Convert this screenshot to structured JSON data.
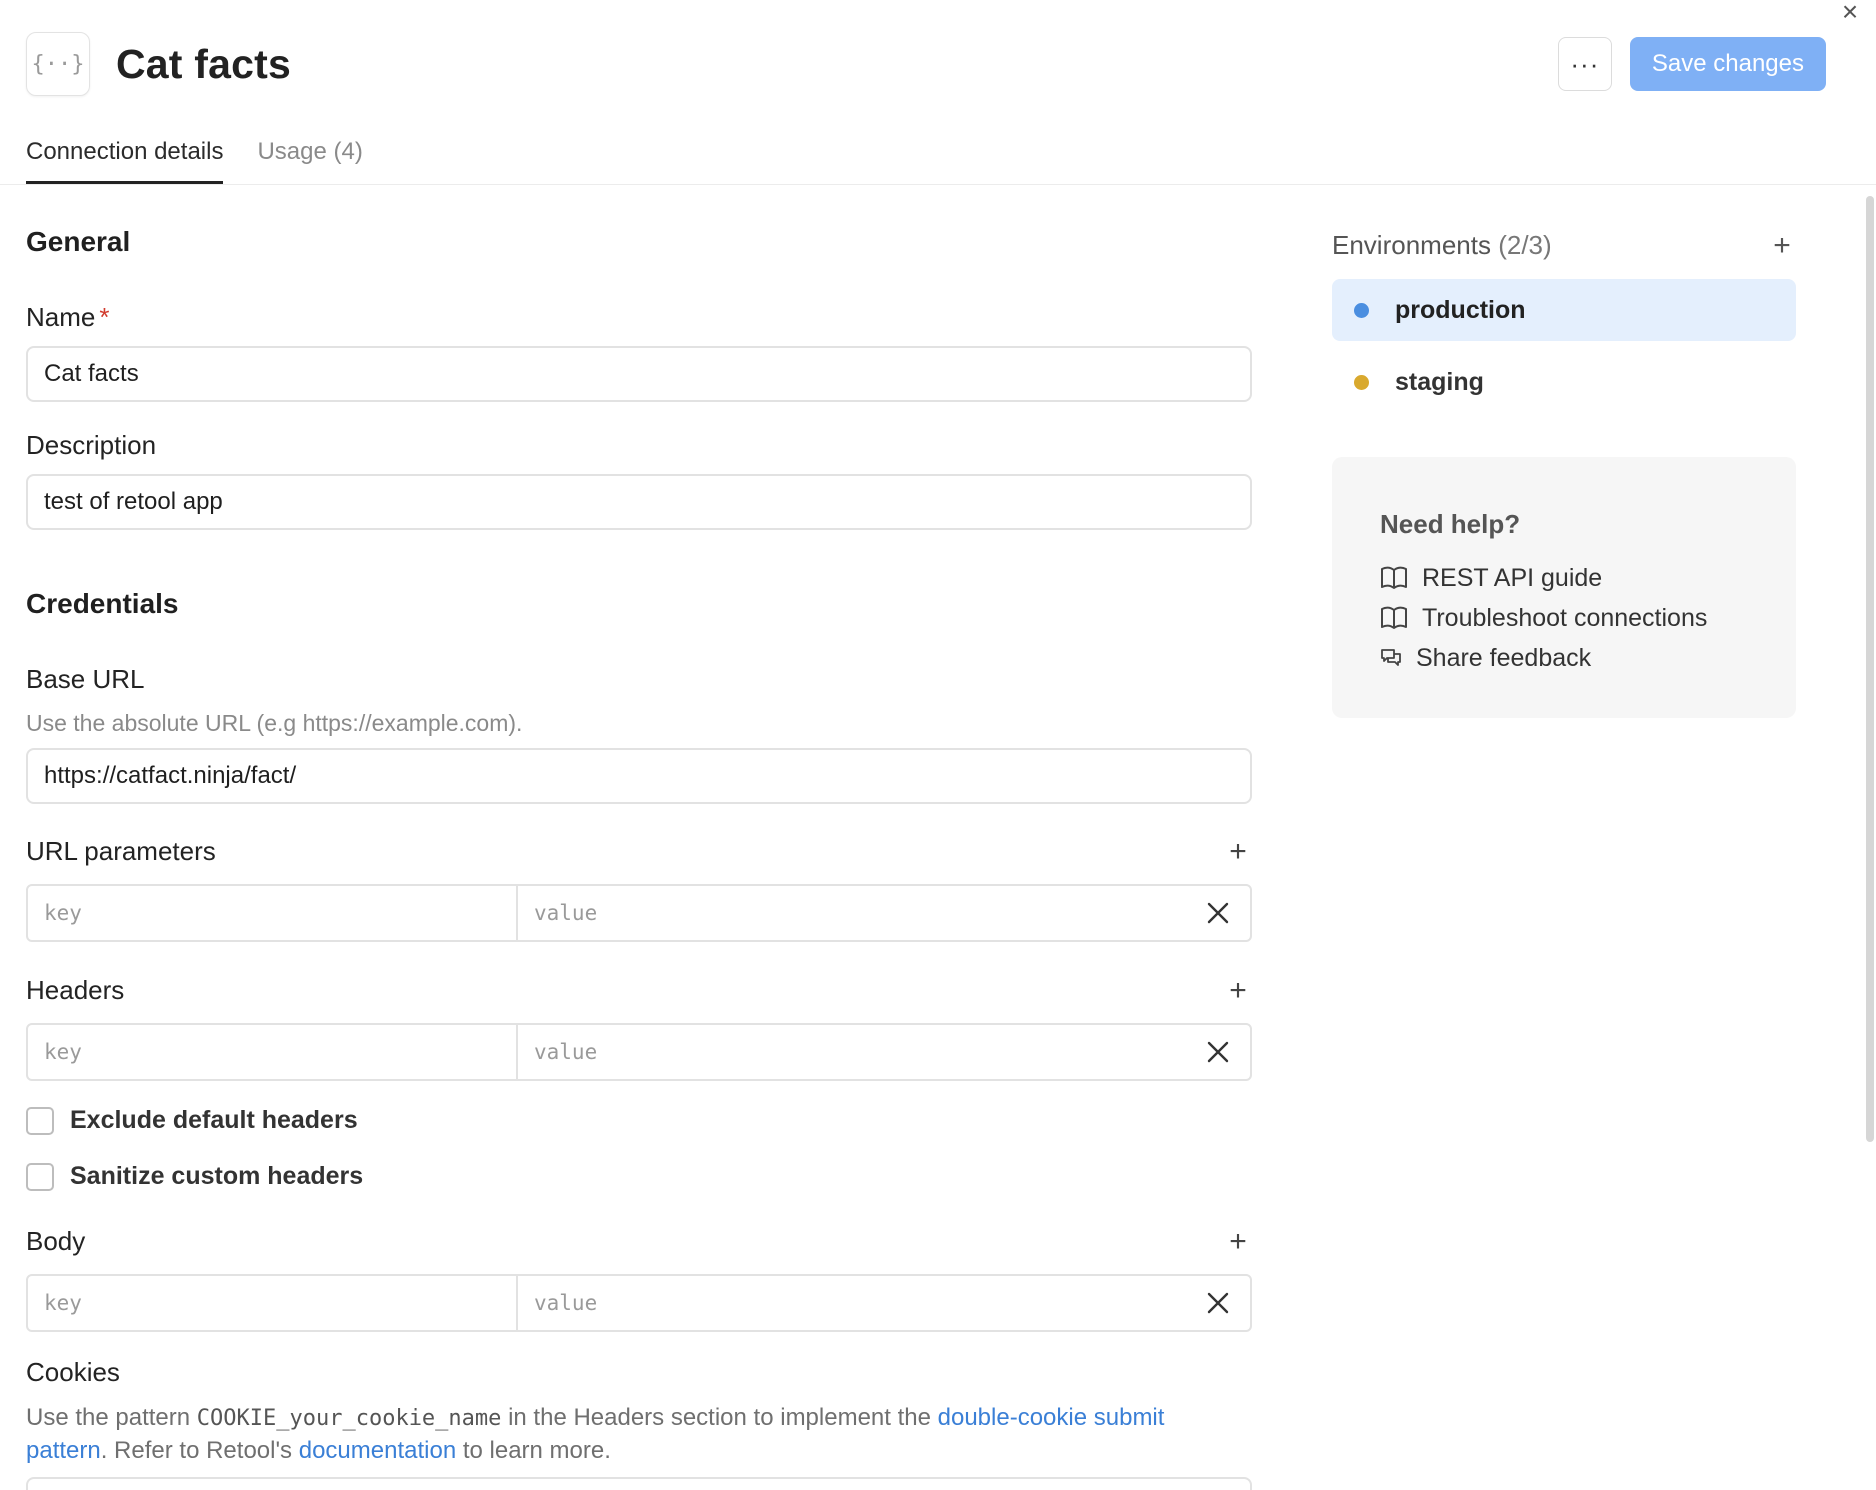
{
  "window": {
    "close_symbol": "×"
  },
  "header": {
    "resource_icon": "braces-icon",
    "resource_icon_glyph": "{··}",
    "title": "Cat facts",
    "more_symbol": "···",
    "save_label": "Save changes",
    "save_color": "#7fb0f5"
  },
  "tabs": [
    {
      "label": "Connection details",
      "active": true
    },
    {
      "label": "Usage (4)",
      "active": false
    }
  ],
  "general": {
    "title": "General",
    "name_label": "Name",
    "required_mark": "*",
    "name_value": "Cat facts",
    "description_label": "Description",
    "description_value": "test of retool app"
  },
  "credentials": {
    "title": "Credentials",
    "base_url_label": "Base URL",
    "base_url_hint": "Use the absolute URL (e.g https://example.com).",
    "base_url_value": "https://catfact.ninja/fact/",
    "url_params": {
      "label": "URL parameters",
      "key_placeholder": "key",
      "value_placeholder": "value"
    },
    "headers": {
      "label": "Headers",
      "key_placeholder": "key",
      "value_placeholder": "value"
    },
    "exclude_default_headers": {
      "label": "Exclude default headers",
      "checked": false
    },
    "sanitize_custom_headers": {
      "label": "Sanitize custom headers",
      "checked": false
    },
    "body": {
      "label": "Body",
      "key_placeholder": "key",
      "value_placeholder": "value"
    },
    "cookies": {
      "label": "Cookies",
      "text_1": "Use the pattern ",
      "code": "COOKIE_your_cookie_name",
      "text_2": " in the Headers section to implement the ",
      "link_1": "double-cookie submit pattern",
      "text_3": ". Refer to Retool's ",
      "link_2": "documentation",
      "text_4": " to learn more."
    }
  },
  "environments": {
    "title": "Environments",
    "count": "(2/3)",
    "items": [
      {
        "label": "production",
        "color": "#4a8ee0",
        "selected": true
      },
      {
        "label": "staging",
        "color": "#d9a92e",
        "selected": false
      }
    ]
  },
  "help": {
    "title": "Need help?",
    "links": [
      {
        "label": "REST API guide",
        "icon": "book-icon"
      },
      {
        "label": "Troubleshoot connections",
        "icon": "book-icon"
      },
      {
        "label": "Share feedback",
        "icon": "chat-icon"
      }
    ]
  }
}
